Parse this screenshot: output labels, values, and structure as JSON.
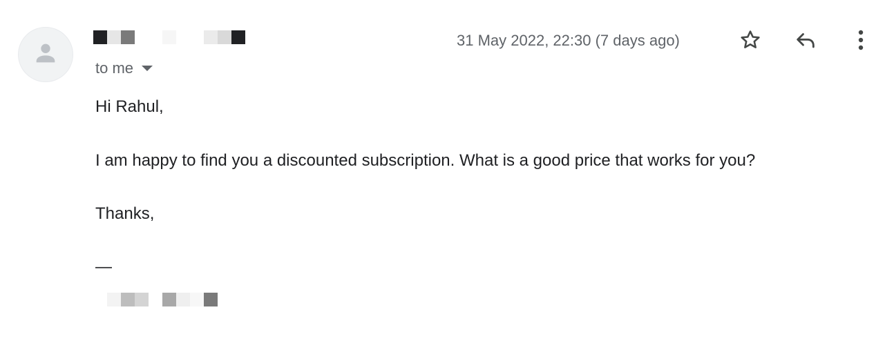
{
  "email": {
    "recipient_label": "to me",
    "timestamp": "31 May 2022, 22:30 (7 days ago)",
    "body": {
      "greeting": "Hi Rahul,",
      "message": "I am happy to find you a discounted subscription. What is a good price that works for you?",
      "closing": "Thanks,",
      "signature_dash": "—"
    }
  },
  "icons": {
    "avatar": "person-icon",
    "recipient_caret": "caret-down-icon",
    "star": "star-icon",
    "reply": "reply-icon",
    "more": "more-vert-icon"
  },
  "colors": {
    "text_primary": "#202124",
    "text_secondary": "#5f6368",
    "avatar_bg": "#f1f3f4"
  }
}
